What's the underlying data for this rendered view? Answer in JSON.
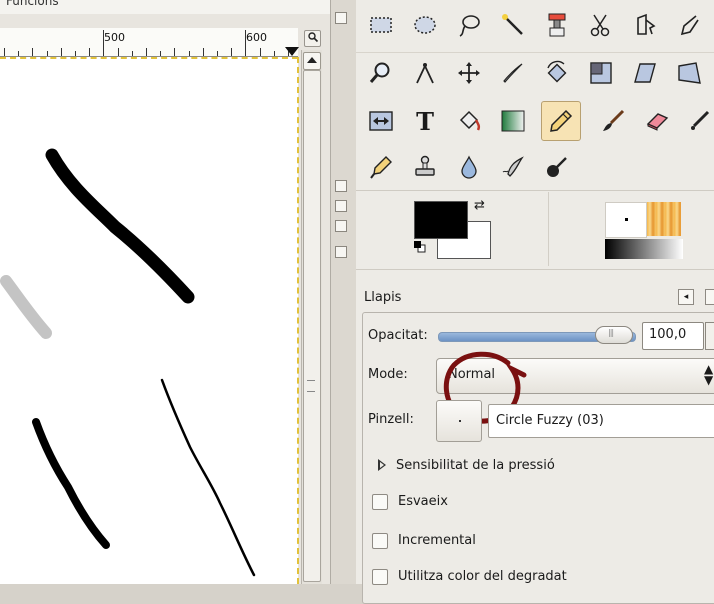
{
  "canvas": {
    "menu_fragment": "Funcions",
    "ruler_labels": [
      "500",
      "600"
    ],
    "zoom_button_icon": "magnifier-icon"
  },
  "toolbox": {
    "tools": [
      {
        "id": "rect-select",
        "icon": "rect-select-icon"
      },
      {
        "id": "ellipse-select",
        "icon": "ellipse-select-icon"
      },
      {
        "id": "free-select",
        "icon": "lasso-icon"
      },
      {
        "id": "fuzzy-select",
        "icon": "magic-wand-icon"
      },
      {
        "id": "color-select",
        "icon": "color-select-icon"
      },
      {
        "id": "scissors",
        "icon": "scissors-icon"
      },
      {
        "id": "foreground-select",
        "icon": "foreground-select-icon"
      },
      {
        "id": "paths",
        "icon": "paths-icon"
      },
      {
        "id": "zoom",
        "icon": "magnifier-icon"
      },
      {
        "id": "measure",
        "icon": "compass-icon"
      },
      {
        "id": "move",
        "icon": "move-icon"
      },
      {
        "id": "crop",
        "icon": "scalpel-icon"
      },
      {
        "id": "rotate",
        "icon": "rotate-icon"
      },
      {
        "id": "scale",
        "icon": "scale-icon"
      },
      {
        "id": "shear",
        "icon": "shear-icon"
      },
      {
        "id": "perspective",
        "icon": "perspective-icon"
      },
      {
        "id": "flip",
        "icon": "flip-icon"
      },
      {
        "id": "text",
        "icon": "text-icon",
        "label": "T"
      },
      {
        "id": "bucket-fill",
        "icon": "bucket-icon"
      },
      {
        "id": "blend",
        "icon": "gradient-icon"
      },
      {
        "id": "pencil",
        "icon": "pencil-icon",
        "active": true
      },
      {
        "id": "paintbrush",
        "icon": "paintbrush-icon"
      },
      {
        "id": "eraser",
        "icon": "eraser-icon"
      },
      {
        "id": "airbrush",
        "icon": "airbrush-icon"
      },
      {
        "id": "ink",
        "icon": "ink-icon"
      },
      {
        "id": "clone",
        "icon": "clone-stamp-icon"
      },
      {
        "id": "blur",
        "icon": "blur-drop-icon"
      },
      {
        "id": "smudge",
        "icon": "smudge-icon"
      },
      {
        "id": "dodge-burn",
        "icon": "dodge-burn-icon"
      }
    ],
    "colors": {
      "foreground": "#000000",
      "background": "#ffffff"
    }
  },
  "tool_options": {
    "title": "Llapis",
    "opacity_label": "Opacitat:",
    "opacity_value": "100,0",
    "opacity_fraction": 1.0,
    "mode_label": "Mode:",
    "mode_value": "Normal",
    "brush_label": "Pinzell:",
    "brush_name": "Circle Fuzzy (03)",
    "pressure_label": "Sensibilitat de la pressió",
    "fade_label": "Esvaeix",
    "incremental_label": "Incremental",
    "gradient_label": "Utilitza color del degradat"
  },
  "accent_colors": {
    "annotation": "#7a1010",
    "selected_tool": "#f7e3b4",
    "marching_ants": "#e2c23a"
  }
}
